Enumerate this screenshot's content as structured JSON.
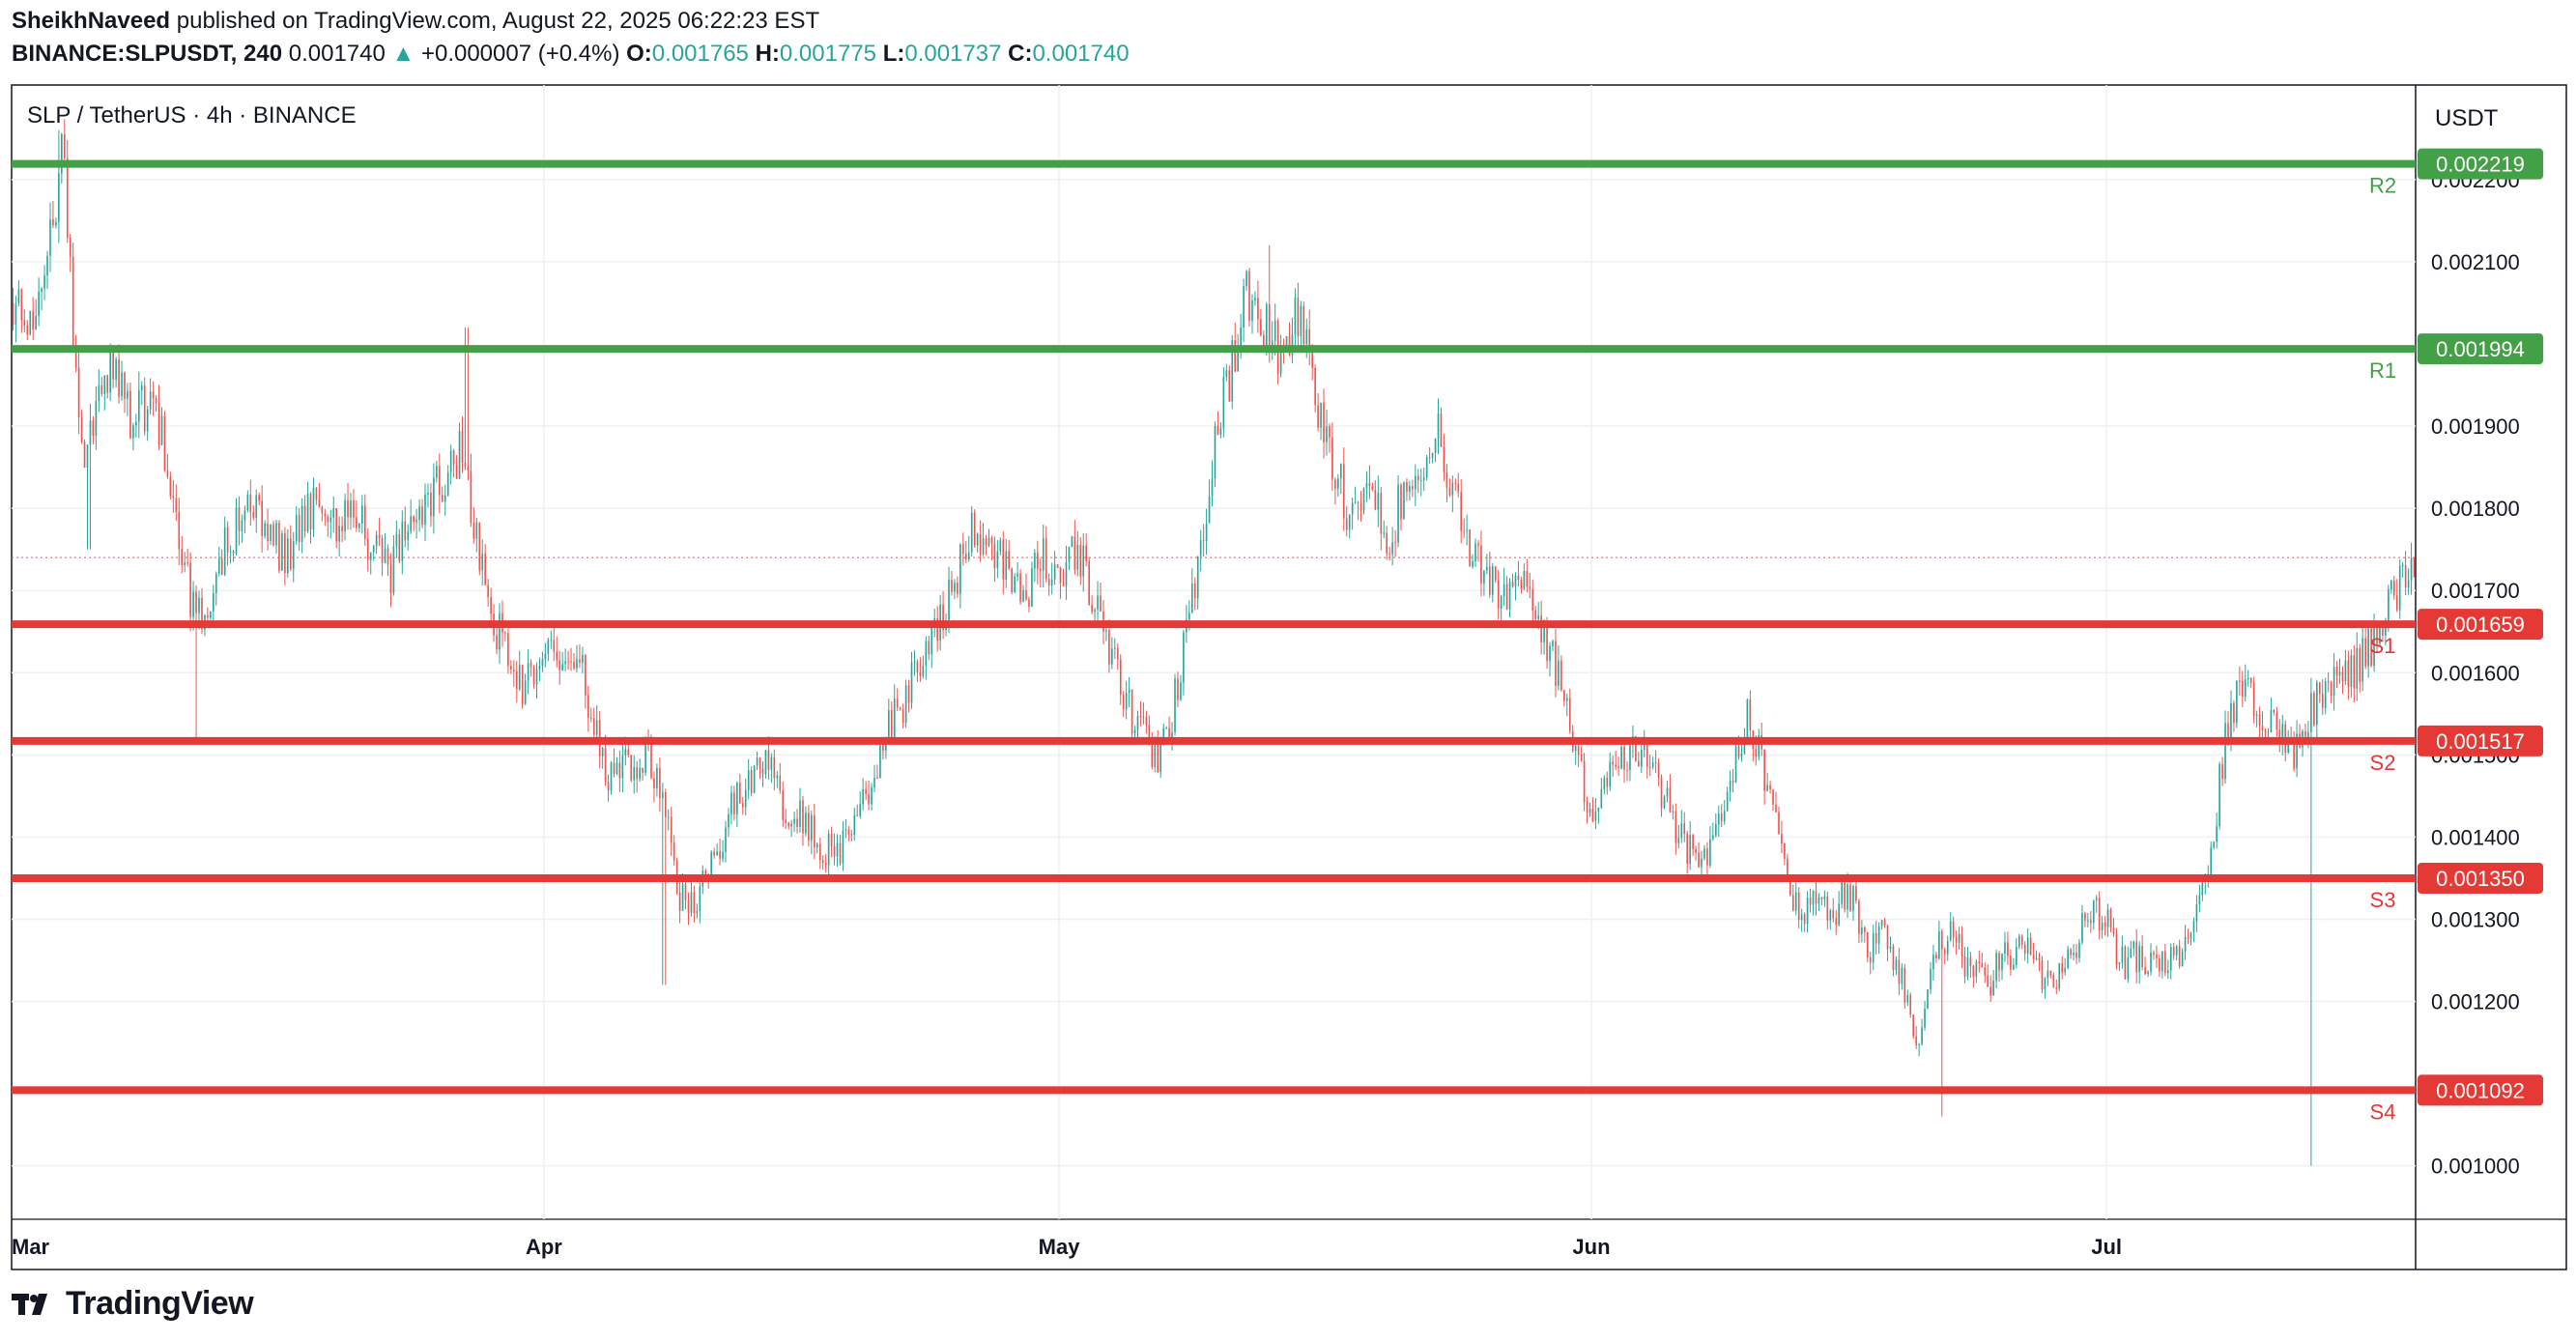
{
  "header": {
    "author": "SheikhNaveed",
    "published_text": "published on TradingView.com, August 22, 2025 06:22:23 EST",
    "symbol": "BINANCE:SLPUSDT, 240",
    "last": "0.001740",
    "arrow": "▲",
    "change": "+0.000007 (+0.4%)",
    "o_label": "O:",
    "o": "0.001765",
    "h_label": "H:",
    "h": "0.001775",
    "l_label": "L:",
    "l": "0.001737",
    "c_label": "C:",
    "c": "0.001740"
  },
  "footer": {
    "brand": "TradingView",
    "logo_icon": "tradingview-logo-icon"
  },
  "chart_data": {
    "type": "candlestick",
    "title": "SLP / TetherUS · 4h · BINANCE",
    "currency": "USDT",
    "ylim": [
      0.000935,
      0.002315
    ],
    "y_ticks": [
      0.001,
      0.0012,
      0.0013,
      0.0014,
      0.0015,
      0.0016,
      0.0017,
      0.0018,
      0.0019,
      0.0021,
      0.0022
    ],
    "y_tick_labels": [
      "0.001000",
      "0.001200",
      "0.001300",
      "0.001400",
      "0.001500",
      "0.001600",
      "0.001700",
      "0.001800",
      "0.001900",
      "0.002100",
      "0.002200"
    ],
    "x_ticks": [
      {
        "label": "Mar",
        "day": 0
      },
      {
        "label": "Apr",
        "day": 31
      },
      {
        "label": "May",
        "day": 61
      },
      {
        "label": "Jun",
        "day": 92
      },
      {
        "label": "Jul",
        "day": 122
      }
    ],
    "x_range_days": [
      0,
      140
    ],
    "grid": true,
    "last_price": 0.00174,
    "colors": {
      "up": "#26a69a",
      "down": "#ef5350",
      "resistance": "#43a047",
      "support": "#e53935",
      "text": "#131722",
      "grid": "#eef0f3"
    },
    "levels": [
      {
        "name": "R2",
        "value": 0.002219,
        "label": "0.002219",
        "kind": "resistance"
      },
      {
        "name": "R1",
        "value": 0.001994,
        "label": "0.001994",
        "kind": "resistance"
      },
      {
        "name": "S1",
        "value": 0.001659,
        "label": "0.001659",
        "kind": "support"
      },
      {
        "name": "S2",
        "value": 0.001517,
        "label": "0.001517",
        "kind": "support"
      },
      {
        "name": "S3",
        "value": 0.00135,
        "label": "0.001350",
        "kind": "support"
      },
      {
        "name": "S4",
        "value": 0.001092,
        "label": "0.001092",
        "kind": "support"
      }
    ],
    "path": [
      [
        0,
        0.00205
      ],
      [
        1,
        0.00202
      ],
      [
        2,
        0.0021
      ],
      [
        3,
        0.00224
      ],
      [
        4,
        0.00186
      ],
      [
        5,
        0.00193
      ],
      [
        6,
        0.00198
      ],
      [
        7,
        0.00191
      ],
      [
        8,
        0.00193
      ],
      [
        9,
        0.00187
      ],
      [
        10,
        0.00172
      ],
      [
        11,
        0.00166
      ],
      [
        12,
        0.00173
      ],
      [
        13,
        0.00178
      ],
      [
        14,
        0.0018
      ],
      [
        15,
        0.00176
      ],
      [
        16,
        0.00174
      ],
      [
        17,
        0.00178
      ],
      [
        18,
        0.00183
      ],
      [
        19,
        0.00177
      ],
      [
        20,
        0.00181
      ],
      [
        21,
        0.00175
      ],
      [
        22,
        0.00172
      ],
      [
        23,
        0.00177
      ],
      [
        24,
        0.00181
      ],
      [
        25,
        0.00183
      ],
      [
        26,
        0.00187
      ],
      [
        27,
        0.00178
      ],
      [
        28,
        0.00167
      ],
      [
        29,
        0.00161
      ],
      [
        30,
        0.00158
      ],
      [
        31,
        0.00164
      ],
      [
        32,
        0.0016
      ],
      [
        33,
        0.00162
      ],
      [
        34,
        0.00152
      ],
      [
        35,
        0.00147
      ],
      [
        36,
        0.00149
      ],
      [
        37,
        0.0015
      ],
      [
        38,
        0.00144
      ],
      [
        39,
        0.00132
      ],
      [
        40,
        0.00133
      ],
      [
        41,
        0.00138
      ],
      [
        42,
        0.00144
      ],
      [
        43,
        0.00146
      ],
      [
        44,
        0.0015
      ],
      [
        45,
        0.00143
      ],
      [
        46,
        0.00142
      ],
      [
        47,
        0.00139
      ],
      [
        48,
        0.00138
      ],
      [
        49,
        0.00141
      ],
      [
        50,
        0.00147
      ],
      [
        51,
        0.00153
      ],
      [
        52,
        0.00156
      ],
      [
        53,
        0.00163
      ],
      [
        54,
        0.00166
      ],
      [
        55,
        0.00172
      ],
      [
        56,
        0.00178
      ],
      [
        57,
        0.00176
      ],
      [
        58,
        0.00172
      ],
      [
        59,
        0.0017
      ],
      [
        60,
        0.00174
      ],
      [
        61,
        0.00171
      ],
      [
        62,
        0.00175
      ],
      [
        63,
        0.00169
      ],
      [
        64,
        0.00163
      ],
      [
        65,
        0.00156
      ],
      [
        66,
        0.00152
      ],
      [
        67,
        0.0015
      ],
      [
        68,
        0.00159
      ],
      [
        69,
        0.00172
      ],
      [
        70,
        0.00187
      ],
      [
        71,
        0.00197
      ],
      [
        72,
        0.00206
      ],
      [
        73,
        0.00202
      ],
      [
        74,
        0.00198
      ],
      [
        75,
        0.00204
      ],
      [
        76,
        0.00192
      ],
      [
        77,
        0.00185
      ],
      [
        78,
        0.00179
      ],
      [
        79,
        0.00184
      ],
      [
        80,
        0.00176
      ],
      [
        81,
        0.00181
      ],
      [
        82,
        0.00185
      ],
      [
        83,
        0.0019
      ],
      [
        84,
        0.00182
      ],
      [
        85,
        0.00174
      ],
      [
        86,
        0.00171
      ],
      [
        87,
        0.0017
      ],
      [
        88,
        0.00172
      ],
      [
        89,
        0.00167
      ],
      [
        90,
        0.0016
      ],
      [
        91,
        0.00151
      ],
      [
        92,
        0.00143
      ],
      [
        93,
        0.00147
      ],
      [
        94,
        0.00149
      ],
      [
        95,
        0.00151
      ],
      [
        96,
        0.00146
      ],
      [
        97,
        0.0014
      ],
      [
        98,
        0.00138
      ],
      [
        99,
        0.00139
      ],
      [
        100,
        0.00145
      ],
      [
        101,
        0.00155
      ],
      [
        102,
        0.00149
      ],
      [
        103,
        0.00138
      ],
      [
        104,
        0.00131
      ],
      [
        105,
        0.00132
      ],
      [
        106,
        0.0013
      ],
      [
        107,
        0.00134
      ],
      [
        108,
        0.00126
      ],
      [
        109,
        0.00128
      ],
      [
        110,
        0.00124
      ],
      [
        111,
        0.00114
      ],
      [
        112,
        0.00126
      ],
      [
        113,
        0.00128
      ],
      [
        114,
        0.00124
      ],
      [
        115,
        0.00122
      ],
      [
        116,
        0.00125
      ],
      [
        117,
        0.00127
      ],
      [
        118,
        0.00124
      ],
      [
        119,
        0.00122
      ],
      [
        120,
        0.00125
      ],
      [
        121,
        0.00131
      ],
      [
        122,
        0.0013
      ],
      [
        123,
        0.00124
      ],
      [
        124,
        0.00126
      ],
      [
        125,
        0.00124
      ],
      [
        126,
        0.00125
      ],
      [
        127,
        0.0013
      ],
      [
        128,
        0.00136
      ],
      [
        129,
        0.00154
      ],
      [
        130,
        0.00158
      ],
      [
        131,
        0.00156
      ],
      [
        132,
        0.00152
      ],
      [
        133,
        0.0015
      ],
      [
        134,
        0.00156
      ],
      [
        135,
        0.00158
      ],
      [
        136,
        0.0016
      ],
      [
        137,
        0.00162
      ],
      [
        138,
        0.00166
      ],
      [
        139,
        0.0017
      ],
      [
        140,
        0.00174
      ]
    ],
    "extremes": [
      {
        "day": 2.8,
        "value": 0.00226,
        "dir": "high"
      },
      {
        "day": 4.5,
        "value": 0.00175,
        "dir": "low"
      },
      {
        "day": 10.8,
        "value": 0.00152,
        "dir": "low"
      },
      {
        "day": 26.5,
        "value": 0.00202,
        "dir": "high"
      },
      {
        "day": 38.0,
        "value": 0.00122,
        "dir": "low"
      },
      {
        "day": 73.2,
        "value": 0.00212,
        "dir": "high"
      },
      {
        "day": 112.4,
        "value": 0.00106,
        "dir": "low"
      },
      {
        "day": 133.9,
        "value": 0.001,
        "dir": "low"
      }
    ]
  }
}
